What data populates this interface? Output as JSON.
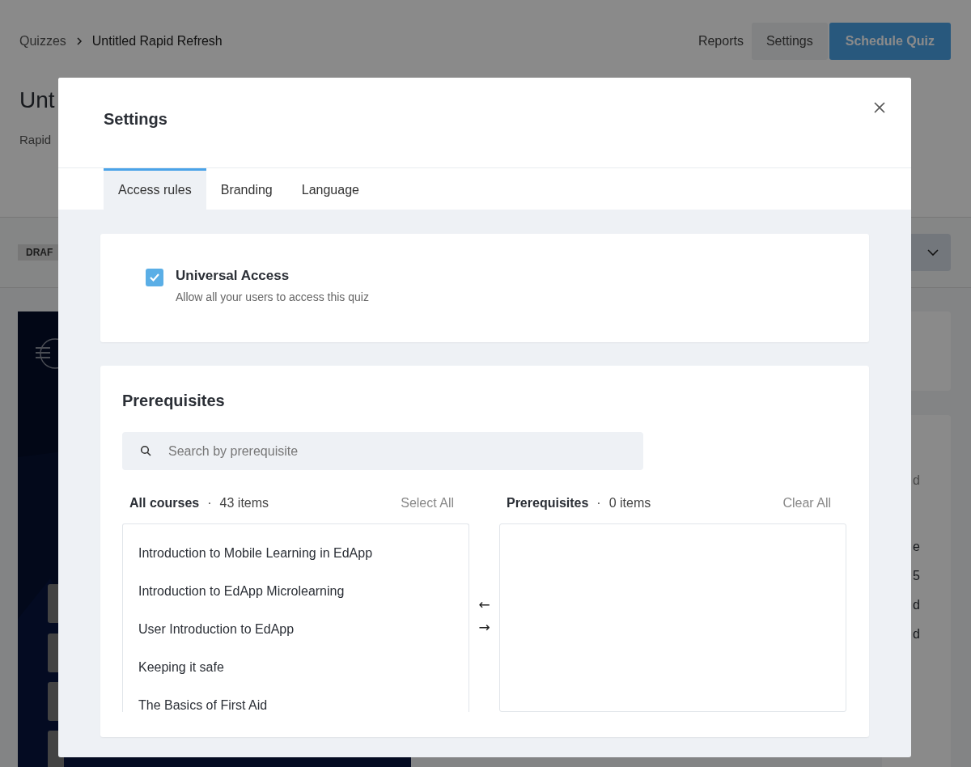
{
  "page": {
    "breadcrumb": [
      {
        "label": "Quizzes"
      },
      {
        "label": "Untitled Rapid Refresh"
      }
    ],
    "actions": [
      {
        "label": "Reports",
        "kind": "link"
      },
      {
        "label": "Settings",
        "kind": "secondary"
      },
      {
        "label": "Schedule Quiz",
        "kind": "primary"
      }
    ],
    "title": "Unt",
    "subtitle": "Rapid",
    "status_badge": "DRAF",
    "side_fragments": [
      {
        "text": "d",
        "muted": true
      },
      {
        "text": "e",
        "muted": false
      },
      {
        "text": "5",
        "muted": false
      },
      {
        "text": "d",
        "muted": false
      },
      {
        "text": "d",
        "muted": false
      }
    ]
  },
  "dialog": {
    "title": "Settings",
    "tabs": [
      {
        "label": "Access rules",
        "selected": true
      },
      {
        "label": "Branding",
        "selected": false
      },
      {
        "label": "Language",
        "selected": false
      }
    ],
    "universal_access": {
      "checked": true,
      "label": "Universal Access",
      "description": "Allow all your users to access this quiz"
    },
    "prerequisites": {
      "title": "Prerequisites",
      "search": {
        "placeholder": "Search by prerequisite"
      },
      "available": {
        "label": "All courses",
        "separator": "·",
        "count": "43 items",
        "action": "Select All",
        "items": [
          {
            "title": "Introduction to Mobile Learning in EdApp"
          },
          {
            "title": "Introduction to EdApp Microlearning"
          },
          {
            "title": "User Introduction to EdApp"
          },
          {
            "title": "Keeping it safe"
          },
          {
            "title": "The Basics of First Aid"
          }
        ]
      },
      "move_buttons": [
        "←",
        "→"
      ],
      "chosen": {
        "label": "Prerequisites",
        "separator": "·",
        "count": "0 items",
        "action": "Clear All"
      }
    }
  }
}
